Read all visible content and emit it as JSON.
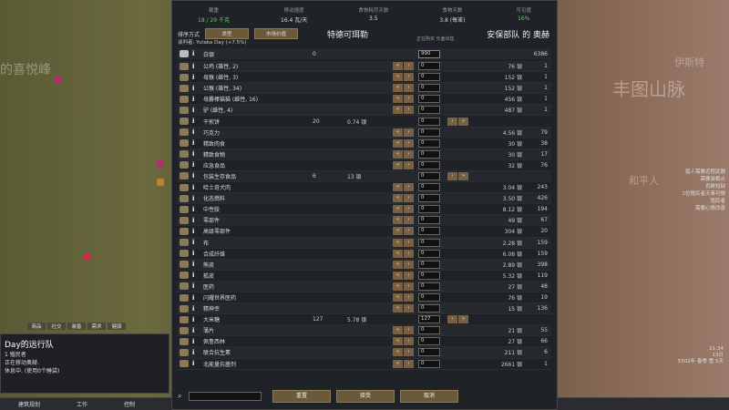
{
  "header": {
    "stats": [
      {
        "label": "载重",
        "value": "18 / 29 千克",
        "green": true
      },
      {
        "label": "移动速度",
        "value": "16.4 瓦/天",
        "green": false
      },
      {
        "label": "食物耗尽天数",
        "value": "3.5",
        "green": false
      },
      {
        "label": "食物天数",
        "value": "3.8 (每革)",
        "green": false
      },
      {
        "label": "可见度",
        "value": "16%",
        "green": true
      }
    ]
  },
  "sort": {
    "label": "排序方式",
    "btn1": "类型",
    "btn2": "市场价值"
  },
  "trade": {
    "left_title": "特德可珥勒",
    "right_title": "安保部队 的 奥赫",
    "negotiator": "谈判者: Yutaka Day (+7.5%)",
    "col_label": "正在购买\n负面出售"
  },
  "silver": {
    "name": "白银",
    "left_count": "0",
    "input": "990",
    "right_count": "6386"
  },
  "rows": [
    {
      "name": "公鸡 (雄性, 2)",
      "lc": "",
      "lm": "",
      "inp": "0",
      "rm": "76 银",
      "rc": "1"
    },
    {
      "name": "母猴 (雌性, 3)",
      "lc": "",
      "lm": "",
      "inp": "0",
      "rm": "152 银",
      "rc": "1"
    },
    {
      "name": "公猴 (雄性, 34)",
      "lc": "",
      "lm": "",
      "inp": "0",
      "rm": "152 银",
      "rc": "1"
    },
    {
      "name": "母麝棒猫猫 (雌性, 16)",
      "lc": "",
      "lm": "",
      "inp": "0",
      "rm": "456 银",
      "rc": "1"
    },
    {
      "name": "驴 (雌性, 4)",
      "lc": "",
      "lm": "",
      "inp": "0",
      "rm": "487 银",
      "rc": "1"
    },
    {
      "name": "干煎饼",
      "lc": "20",
      "lm": "0.74 银",
      "inp": "0",
      "rm": "",
      "rc": ""
    },
    {
      "name": "巧克力",
      "lc": "",
      "lm": "",
      "inp": "0",
      "rm": "4.56 银",
      "rc": "79"
    },
    {
      "name": "精致肉食",
      "lc": "",
      "lm": "",
      "inp": "0",
      "rm": "30 银",
      "rc": "38"
    },
    {
      "name": "精致食物",
      "lc": "",
      "lm": "",
      "inp": "0",
      "rm": "30 银",
      "rc": "17"
    },
    {
      "name": "应急食品",
      "lc": "",
      "lm": "",
      "inp": "0",
      "rm": "32 银",
      "rc": "76"
    },
    {
      "name": "包装生存食品",
      "lc": "6",
      "lm": "13 银",
      "inp": "0",
      "rm": "",
      "rc": ""
    },
    {
      "name": "哈士奇犬肉",
      "lc": "",
      "lm": "",
      "inp": "0",
      "rm": "3.04 银",
      "rc": "243"
    },
    {
      "name": "化态燃料",
      "lc": "",
      "lm": "",
      "inp": "0",
      "rm": "3.50 银",
      "rc": "426"
    },
    {
      "name": "中性肢",
      "lc": "",
      "lm": "",
      "inp": "0",
      "rm": "8.12 银",
      "rc": "194"
    },
    {
      "name": "零部件",
      "lc": "",
      "lm": "",
      "inp": "0",
      "rm": "49 银",
      "rc": "67"
    },
    {
      "name": "高级零部件",
      "lc": "",
      "lm": "",
      "inp": "0",
      "rm": "304 银",
      "rc": "20"
    },
    {
      "name": "布",
      "lc": "",
      "lm": "",
      "inp": "0",
      "rm": "2.28 银",
      "rc": "159"
    },
    {
      "name": "合成纤维",
      "lc": "",
      "lm": "",
      "inp": "0",
      "rm": "6.08 银",
      "rc": "159"
    },
    {
      "name": "熊皮",
      "lc": "",
      "lm": "",
      "inp": "0",
      "rm": "2.89 银",
      "rc": "398"
    },
    {
      "name": "狐皮",
      "lc": "",
      "lm": "",
      "inp": "0",
      "rm": "5.32 银",
      "rc": "119"
    },
    {
      "name": "医药",
      "lc": "",
      "lm": "",
      "inp": "0",
      "rm": "27 银",
      "rc": "48"
    },
    {
      "name": "闪耀世界医药",
      "lc": "",
      "lm": "",
      "inp": "0",
      "rm": "76 银",
      "rc": "19"
    },
    {
      "name": "精神幸",
      "lc": "",
      "lm": "",
      "inp": "0",
      "rm": "15 银",
      "rc": "136"
    },
    {
      "name": "大米糖",
      "lc": "127",
      "lm": "5.78 银",
      "inp": "127",
      "rm": "",
      "rc": ""
    },
    {
      "name": "薄片",
      "lc": "",
      "lm": "",
      "inp": "0",
      "rm": "21 银",
      "rc": "55"
    },
    {
      "name": "佩鲁西林",
      "lc": "",
      "lm": "",
      "inp": "0",
      "rm": "27 银",
      "rc": "66"
    },
    {
      "name": "联合抗生素",
      "lc": "",
      "lm": "",
      "inp": "0",
      "rm": "211 银",
      "rc": "6"
    },
    {
      "name": "北能量抗菌剂",
      "lc": "",
      "lm": "",
      "inp": "0",
      "rm": "2661 银",
      "rc": "1"
    }
  ],
  "footer": {
    "reset": "重置",
    "accept": "接受",
    "cancel": "取消"
  },
  "caravan": {
    "title": "Day的远行队",
    "line1": "1 殖民者",
    "line2": "正在移动奥赫.",
    "line3": "休息中. (使用0个睡袋)"
  },
  "tabs": [
    "商品",
    "社交",
    "装备",
    "需求",
    "健康"
  ],
  "bottombar": [
    "建筑规划",
    "工作",
    "控制"
  ],
  "map": {
    "label1": "的喜悦峰",
    "label2": "丰图山脉",
    "label3": "和平人",
    "label4": "伊斯特"
  },
  "log": [
    "猎人需要近程武器",
    "需要装载点",
    "农耕短缺",
    "2位殖民者无事可做",
    "殖民者",
    "需要心情改善"
  ],
  "clock": {
    "time": "21:34",
    "day": "13日",
    "year": "5502年 春季 雪 5天"
  }
}
